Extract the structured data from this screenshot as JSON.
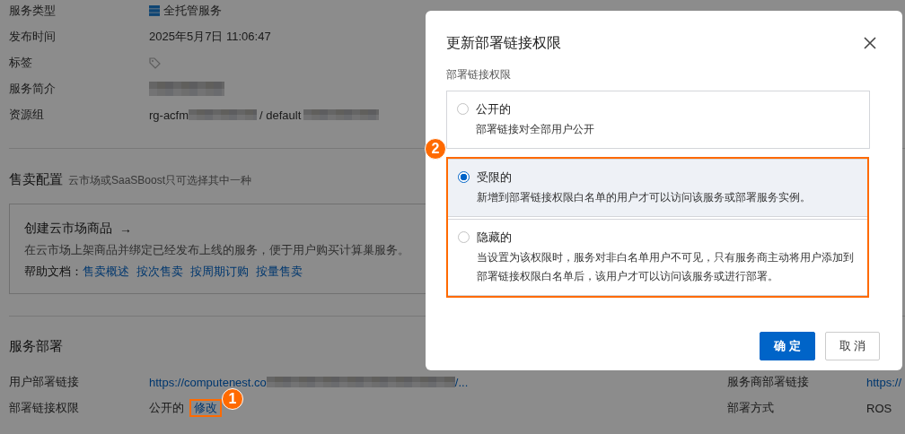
{
  "page": {
    "details": [
      {
        "label": "服务类型",
        "kind": "service-type",
        "value": "全托管服务"
      },
      {
        "label": "发布时间",
        "kind": "text",
        "value": "2025年5月7日 11:06:47"
      },
      {
        "label": "标签",
        "kind": "tag"
      },
      {
        "label": "服务简介",
        "kind": "redacted"
      },
      {
        "label": "资源组",
        "kind": "resource",
        "parts": [
          "rg-acfm",
          "/ default"
        ]
      }
    ],
    "sales": {
      "title": "售卖配置",
      "hint": "云市场或SaaSBoost只可选择其中一种",
      "card": {
        "title": "创建云市场商品",
        "arrow": "→",
        "desc": "在云市场上架商品并绑定已经发布上线的服务，便于用户购买计算巢服务。",
        "help_label": "帮助文档：",
        "links": [
          "售卖概述",
          "按次售卖",
          "按周期订购",
          "按量售卖"
        ]
      }
    },
    "deploy": {
      "title": "服务部署",
      "rows": [
        {
          "label": "用户部署链接",
          "kind": "link-redacted",
          "value": "https://computenest.co",
          "suffix": "/...",
          "right": {
            "label": "服务商部署链接",
            "value": "https://",
            "kind": "link"
          }
        },
        {
          "label": "部署链接权限",
          "kind": "action",
          "value": "公开的",
          "action": "修改",
          "callout": "1",
          "right": {
            "label": "部署方式",
            "value": "ROS",
            "kind": "text"
          }
        }
      ]
    }
  },
  "dialog": {
    "title": "更新部署链接权限",
    "field_label": "部署链接权限",
    "callout": "2",
    "options": [
      {
        "title": "公开的",
        "desc": "部署链接对全部用户公开",
        "selected": false,
        "highlighted": false
      },
      {
        "title": "受限的",
        "desc": "新增到部署链接权限白名单的用户才可以访问该服务或部署服务实例。",
        "selected": true,
        "highlighted": true
      },
      {
        "title": "隐藏的",
        "desc": "当设置为该权限时，服务对非白名单用户不可见，只有服务商主动将用户添加到部署链接权限白名单后，该用户才可以访问该服务或进行部署。",
        "selected": false,
        "highlighted": true
      }
    ],
    "buttons": [
      {
        "label": "确 定",
        "kind": "primary"
      },
      {
        "label": "取 消",
        "kind": "default"
      }
    ]
  }
}
